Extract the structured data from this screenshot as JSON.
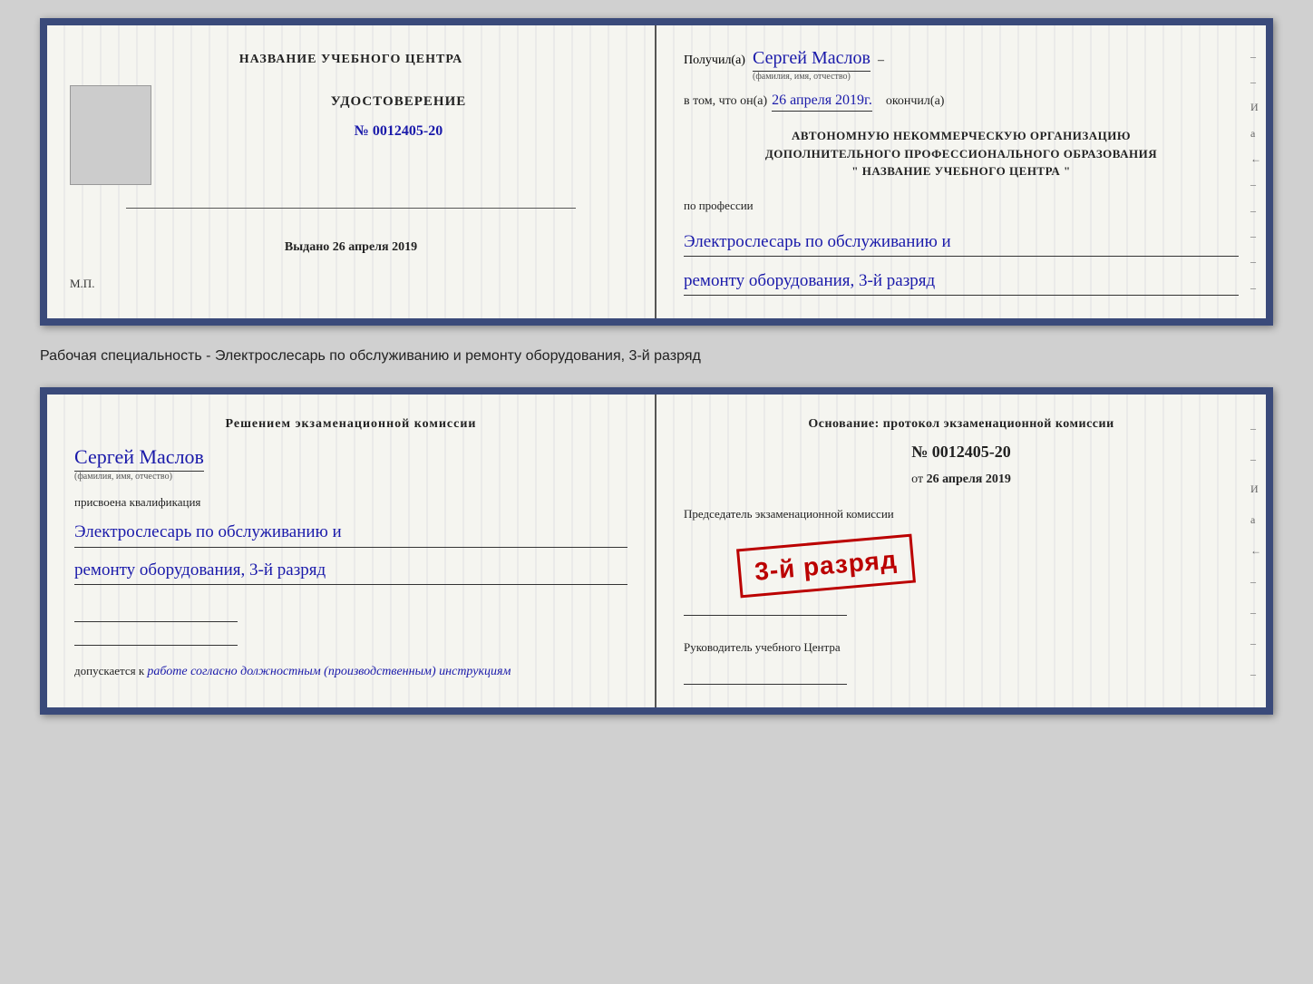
{
  "doc1": {
    "left": {
      "center_title": "НАЗВАНИЕ УЧЕБНОГО ЦЕНТРА",
      "cert_title": "УДОСТОВЕРЕНИЕ",
      "cert_number": "№ 0012405-20",
      "issued_label": "Выдано",
      "issued_date": "26 апреля 2019",
      "mp_label": "М.П."
    },
    "right": {
      "received_label": "Получил(а)",
      "recipient_name": "Сергей Маслов",
      "name_sublabel": "(фамилия, имя, отчество)",
      "dash": "–",
      "date_prefix": "в том, что он(а)",
      "date_value": "26 апреля 2019г.",
      "finished_label": "окончил(а)",
      "org_line1": "АВТОНОМНУЮ НЕКОММЕРЧЕСКУЮ ОРГАНИЗАЦИЮ",
      "org_line2": "ДОПОЛНИТЕЛЬНОГО ПРОФЕССИОНАЛЬНОГО ОБРАЗОВАНИЯ",
      "org_line3": "\" НАЗВАНИЕ УЧЕБНОГО ЦЕНТРА \"",
      "profession_label": "по профессии",
      "profession_line1": "Электрослесарь по обслуживанию и",
      "profession_line2": "ремонту оборудования, 3-й разряд"
    }
  },
  "between": {
    "text": "Рабочая специальность - Электрослесарь по обслуживанию и ремонту оборудования, 3-й разряд"
  },
  "doc2": {
    "left": {
      "decision_title": "Решением экзаменационной комиссии",
      "person_name": "Сергей Маслов",
      "name_sublabel": "(фамилия, имя, отчество)",
      "assigned_label": "присвоена квалификация",
      "profession_line1": "Электрослесарь по обслуживанию и",
      "profession_line2": "ремонту оборудования, 3-й разряд",
      "allowed_prefix": "допускается к",
      "allowed_text": "работе согласно должностным (производственным) инструкциям"
    },
    "right": {
      "basis_label": "Основание: протокол экзаменационной комиссии",
      "cert_number": "№ 0012405-20",
      "date_prefix": "от",
      "date_value": "26 апреля 2019",
      "chairman_label": "Председатель экзаменационной комиссии",
      "stamp_text": "3-й разряд",
      "head_label": "Руководитель учебного Центра"
    }
  },
  "side_marks": {
    "mark1": "И",
    "mark2": "а",
    "mark3": "←",
    "mark4": "–",
    "mark5": "–",
    "mark6": "–",
    "mark7": "–"
  }
}
